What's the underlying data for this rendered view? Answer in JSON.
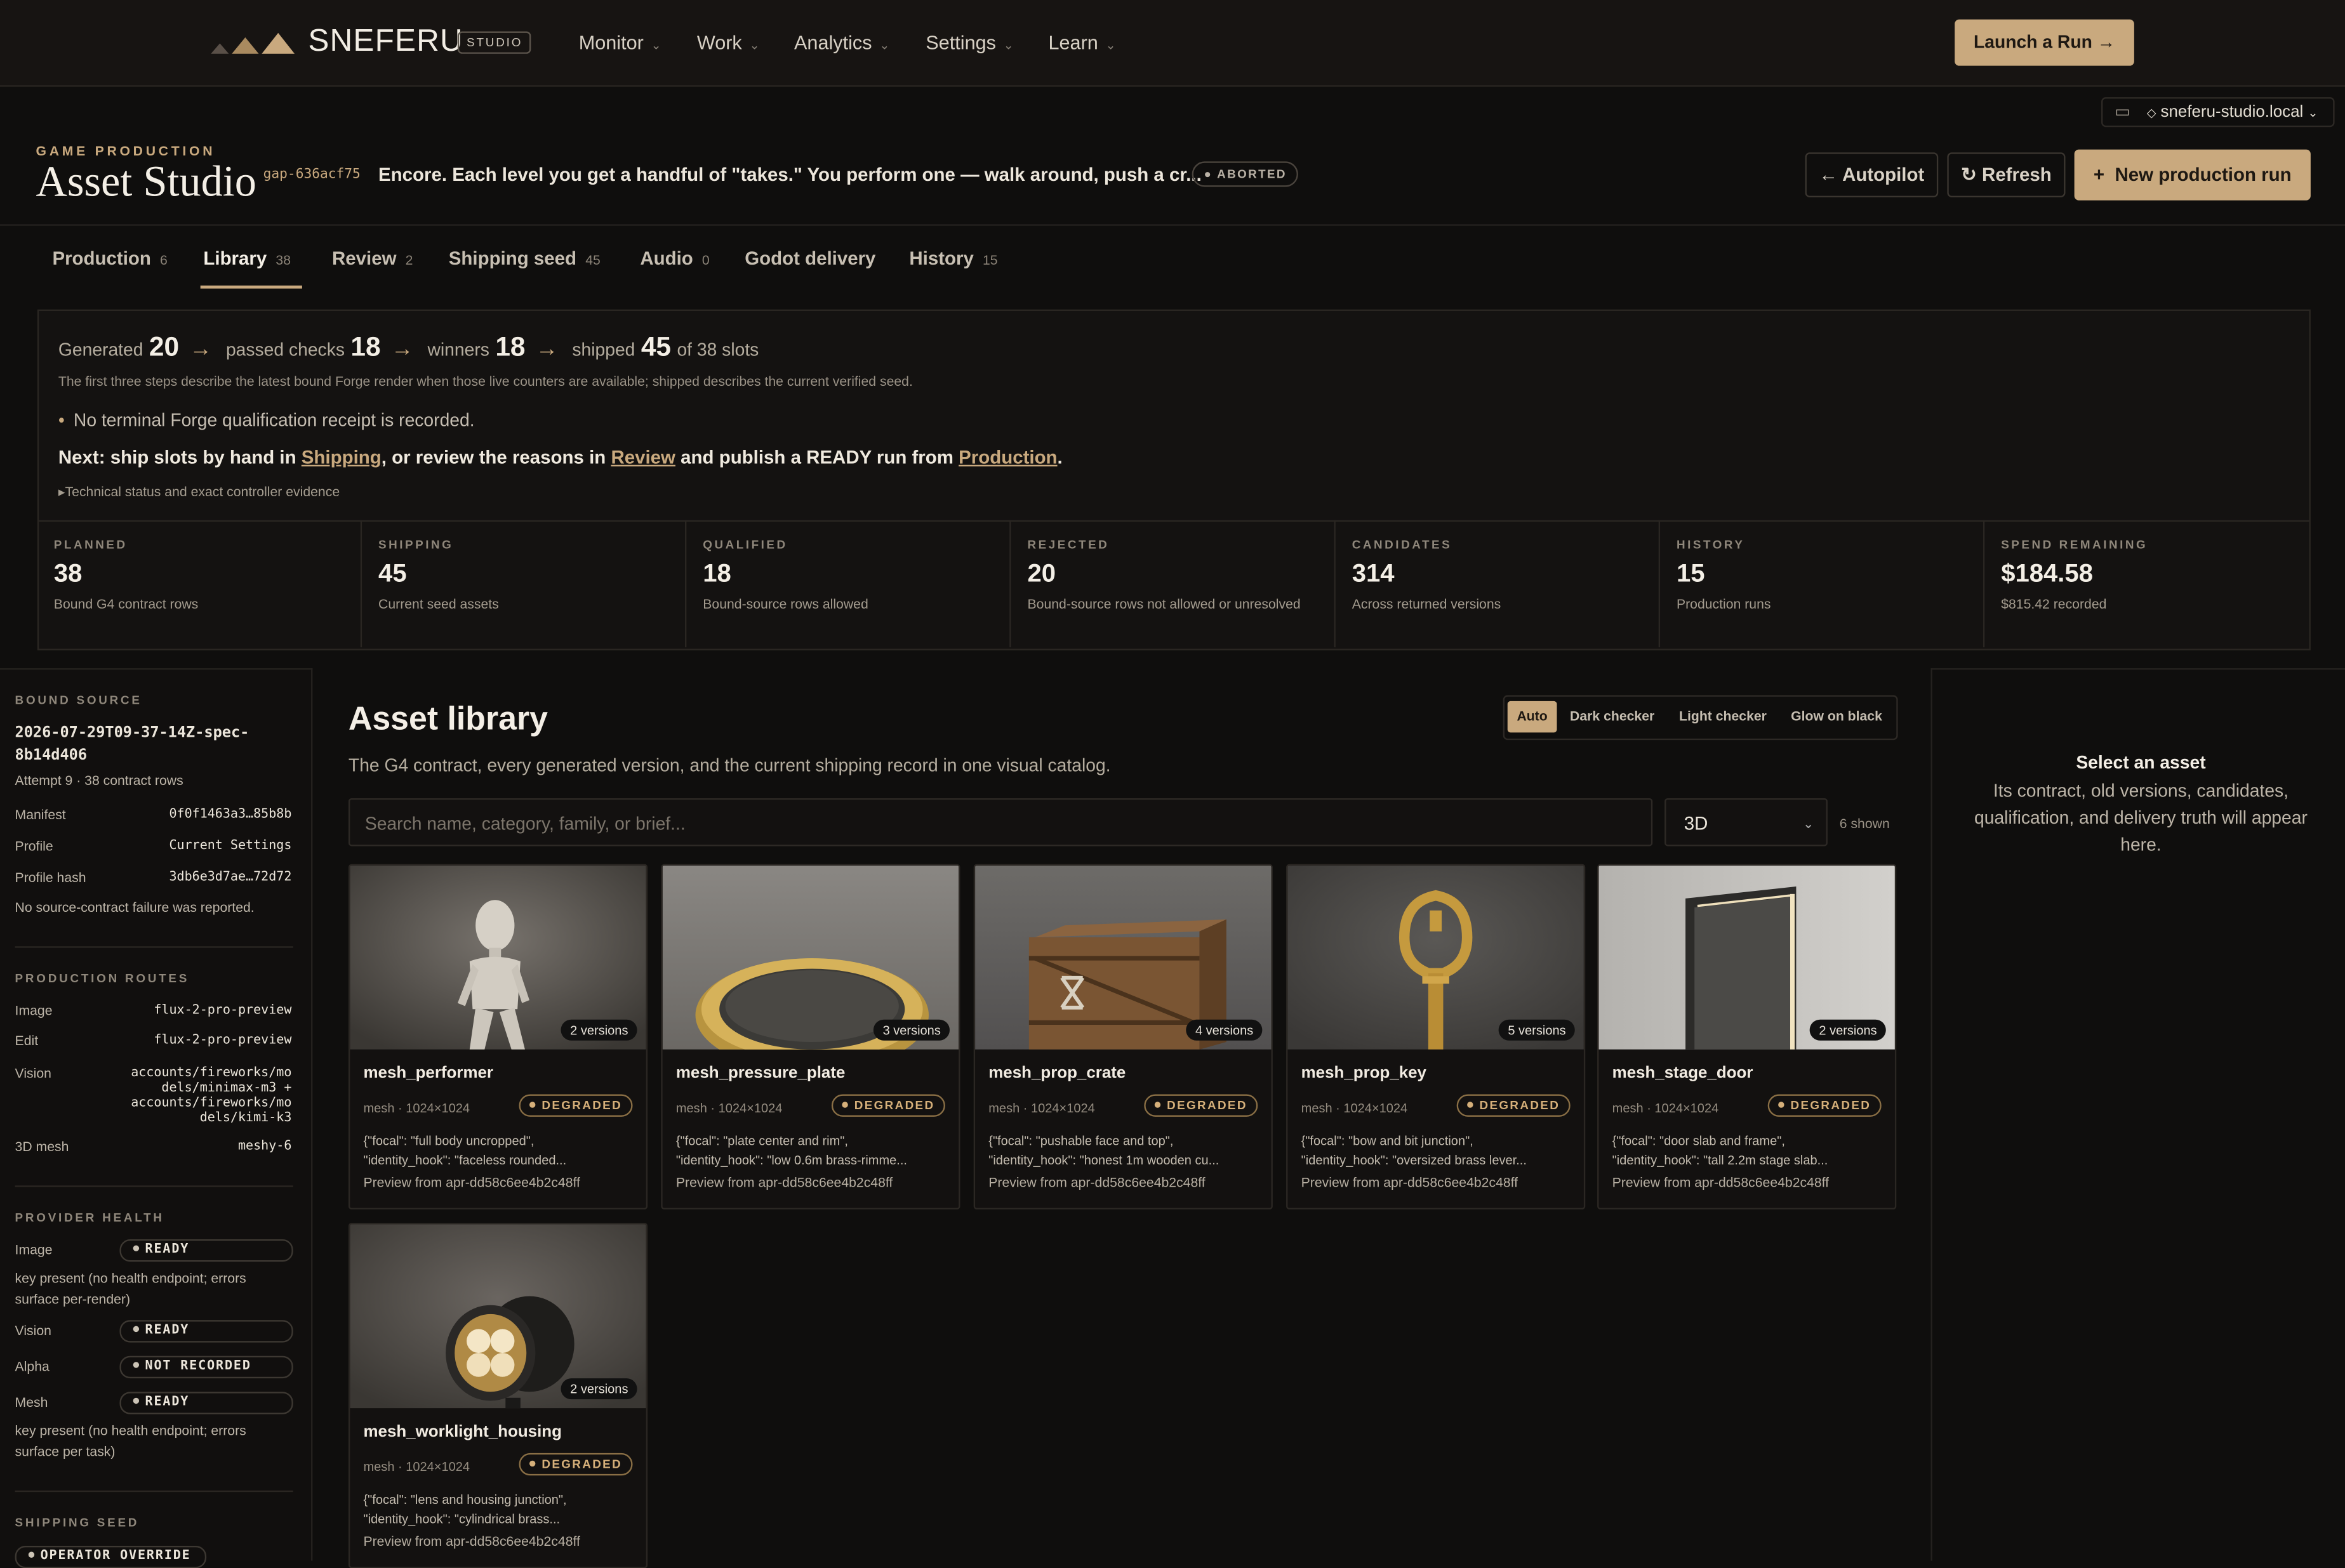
{
  "nav": {
    "brand": "SNEFERU",
    "studio": "STUDIO",
    "menu": [
      {
        "label": "Monitor"
      },
      {
        "label": "Work"
      },
      {
        "label": "Analytics"
      },
      {
        "label": "Settings"
      },
      {
        "label": "Learn"
      }
    ],
    "launch_label": "Launch a Run",
    "host": "sneferu-studio.local"
  },
  "header": {
    "eyebrow": "GAME PRODUCTION",
    "title": "Asset Studio",
    "gap_id": "gap-636acf75",
    "brief": "Encore. Each level you get a handful of \"takes.\" You perform one — walk around, push a cr...",
    "status": "ABORTED",
    "autopilot_label": "Autopilot",
    "refresh_label": "Refresh",
    "new_run_label": "New production run"
  },
  "tabs": [
    {
      "label": "Production",
      "count": "6"
    },
    {
      "label": "Library",
      "count": "38"
    },
    {
      "label": "Review",
      "count": "2"
    },
    {
      "label": "Shipping seed",
      "count": "45"
    },
    {
      "label": "Audio",
      "count": "0"
    },
    {
      "label": "Godot delivery",
      "count": ""
    },
    {
      "label": "History",
      "count": "15"
    }
  ],
  "summary": {
    "generated_label": "Generated",
    "generated": "20",
    "passed_label": "passed checks",
    "passed": "18",
    "winners_label": "winners",
    "winners": "18",
    "shipped_label": "shipped",
    "shipped": "45",
    "slots_text": "of 38 slots",
    "note": "The first three steps describe the latest bound Forge render when those live counters are available; shipped describes the current verified seed.",
    "bullet": "No terminal Forge qualification receipt is recorded.",
    "next_prefix": "Next: ship slots by hand in ",
    "next_link1": "Shipping",
    "next_mid": ", or review the reasons in ",
    "next_link2": "Review",
    "next_mid2": " and publish a READY run from ",
    "next_link3": "Production",
    "next_end": ".",
    "details": "Technical status and exact controller evidence"
  },
  "stats": [
    {
      "label": "PLANNED",
      "value": "38",
      "sub": "Bound G4 contract rows"
    },
    {
      "label": "SHIPPING",
      "value": "45",
      "sub": "Current seed assets"
    },
    {
      "label": "QUALIFIED",
      "value": "18",
      "sub": "Bound-source rows allowed"
    },
    {
      "label": "REJECTED",
      "value": "20",
      "sub": "Bound-source rows not allowed or unresolved"
    },
    {
      "label": "CANDIDATES",
      "value": "314",
      "sub": "Across returned versions"
    },
    {
      "label": "HISTORY",
      "value": "15",
      "sub": "Production runs"
    },
    {
      "label": "SPEND REMAINING",
      "value": "$184.58",
      "sub": "$815.42 recorded"
    }
  ],
  "sidebar": {
    "bound_source_h": "BOUND SOURCE",
    "source_id_1": "2026-07-29T09-37-14Z-spec-",
    "source_id_2": "8b14d406",
    "attempt": "Attempt 9 · 38 contract rows",
    "rows": [
      {
        "k": "Manifest",
        "v": "0f0f1463a3…85b8b"
      },
      {
        "k": "Profile",
        "v": "Current Settings"
      },
      {
        "k": "Profile hash",
        "v": "3db6e3d7ae…72d72"
      }
    ],
    "no_failure": "No source-contract failure was reported.",
    "routes_h": "PRODUCTION ROUTES",
    "routes": [
      {
        "k": "Image",
        "v": "flux-2-pro-preview"
      },
      {
        "k": "Edit",
        "v": "flux-2-pro-preview"
      },
      {
        "k": "Vision",
        "v1": "accounts/fireworks/mo",
        "v2": "dels/minimax-m3 +",
        "v3": "accounts/fireworks/mo",
        "v4": "dels/kimi-k3"
      },
      {
        "k": "3D mesh",
        "v": "meshy-6"
      }
    ],
    "health_h": "PROVIDER HEALTH",
    "health": [
      {
        "k": "Image",
        "v": "READY"
      },
      {
        "k": "Vision",
        "v": "READY"
      },
      {
        "k": "Alpha",
        "v": "NOT RECORDED"
      },
      {
        "k": "Mesh",
        "v": "READY"
      }
    ],
    "image_note_1": "key present (no health endpoint; errors",
    "image_note_2": "surface per-render)",
    "mesh_note_1": "key present (no health endpoint; errors",
    "mesh_note_2": "surface per task)",
    "shipping_h": "SHIPPING SEED",
    "shipping_pill": "OPERATOR OVERRIDE"
  },
  "library": {
    "title": "Asset library",
    "desc": "The G4 contract, every generated version, and the current shipping record in one visual catalog.",
    "backgrounds": [
      "Auto",
      "Dark checker",
      "Light checker",
      "Glow on black"
    ],
    "search_placeholder": "Search name, category, family, or brief...",
    "filter": "3D",
    "shown": "6 shown",
    "cards": [
      {
        "name": "mesh_performer",
        "versions": "2 versions",
        "meta": "mesh · 1024×1024",
        "status": "DEGRADED",
        "hook1": "{\"focal\": \"full body uncropped\",",
        "hook2": "\"identity_hook\": \"faceless rounded...",
        "preview": "Preview from apr-dd58c6ee4b2c48ff",
        "icon": "mannequin-figure"
      },
      {
        "name": "mesh_pressure_plate",
        "versions": "3 versions",
        "meta": "mesh · 1024×1024",
        "status": "DEGRADED",
        "hook1": "{\"focal\": \"plate center and rim\",",
        "hook2": "\"identity_hook\": \"low 0.6m brass-rimme...",
        "preview": "Preview from apr-dd58c6ee4b2c48ff",
        "icon": "brass-plate"
      },
      {
        "name": "mesh_prop_crate",
        "versions": "4 versions",
        "meta": "mesh · 1024×1024",
        "status": "DEGRADED",
        "hook1": "{\"focal\": \"pushable face and top\",",
        "hook2": "\"identity_hook\": \"honest 1m wooden cu...",
        "preview": "Preview from apr-dd58c6ee4b2c48ff",
        "icon": "wooden-crate"
      },
      {
        "name": "mesh_prop_key",
        "versions": "5 versions",
        "meta": "mesh · 1024×1024",
        "status": "DEGRADED",
        "hook1": "{\"focal\": \"bow and bit junction\",",
        "hook2": "\"identity_hook\": \"oversized brass lever...",
        "preview": "Preview from apr-dd58c6ee4b2c48ff",
        "icon": "brass-key"
      },
      {
        "name": "mesh_stage_door",
        "versions": "2 versions",
        "meta": "mesh · 1024×1024",
        "status": "DEGRADED",
        "hook1": "{\"focal\": \"door slab and frame\",",
        "hook2": "\"identity_hook\": \"tall 2.2m stage slab...",
        "preview": "Preview from apr-dd58c6ee4b2c48ff",
        "icon": "stage-door"
      },
      {
        "name": "mesh_worklight_housing",
        "versions": "2 versions",
        "meta": "mesh · 1024×1024",
        "status": "DEGRADED",
        "hook1": "{\"focal\": \"lens and housing junction\",",
        "hook2": "\"identity_hook\": \"cylindrical brass...",
        "preview": "Preview from apr-dd58c6ee4b2c48ff",
        "icon": "worklight"
      }
    ]
  },
  "detail": {
    "title": "Select an asset",
    "desc": "Its contract, old versions, candidates, qualification, and delivery truth will appear here."
  },
  "colors": {
    "accent": "#c9a97e",
    "background": "#0f0e0d",
    "degraded": "#d6b07a"
  }
}
